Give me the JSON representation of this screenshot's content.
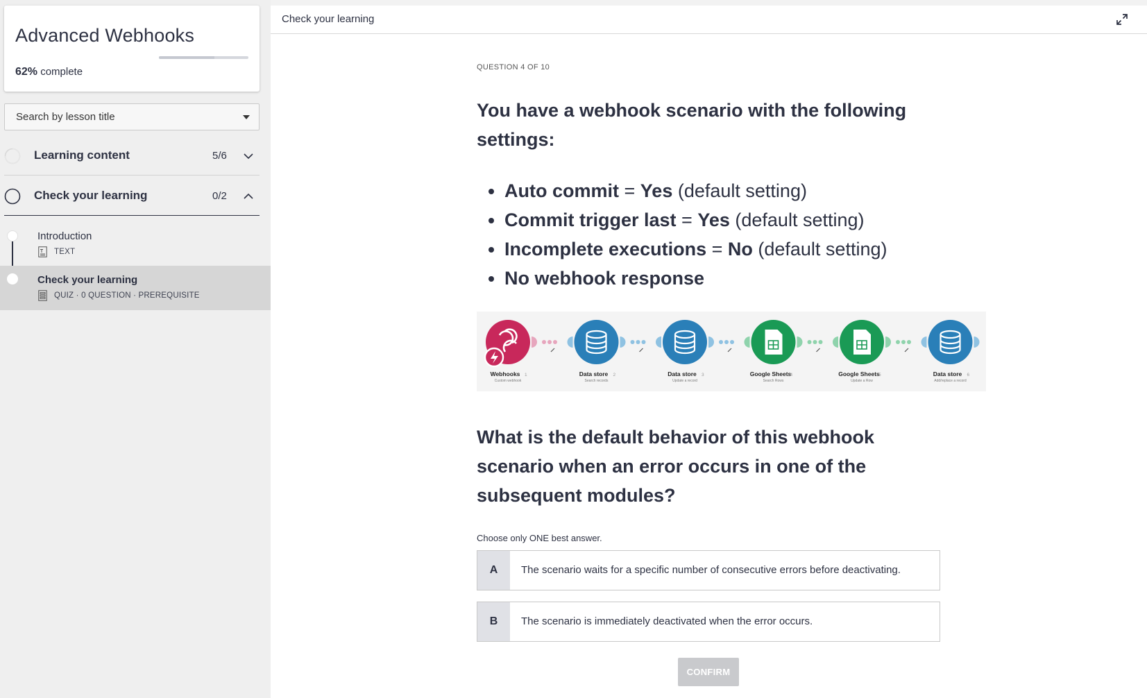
{
  "sidebar": {
    "course_title": "Advanced Webhooks",
    "progress_percent": "62%",
    "progress_suffix": "complete",
    "progress_fraction": 0.62,
    "search_placeholder": "Search by lesson title",
    "sections": [
      {
        "label": "Learning content",
        "count": "5/6",
        "state": "collapsed"
      },
      {
        "label": "Check your learning",
        "count": "0/2",
        "state": "expanded"
      }
    ],
    "lessons": [
      {
        "title": "Introduction",
        "meta": "TEXT",
        "icon": "text-doc-icon"
      },
      {
        "title": "Check your learning",
        "meta": "QUIZ · 0 QUESTION · PREREQUISITE",
        "icon": "quiz-icon"
      }
    ]
  },
  "main": {
    "topbar_title": "Check your learning",
    "question_number": "QUESTION 4 OF 10",
    "question_heading": "You have a webhook scenario with the following settings:",
    "settings": [
      {
        "key": "Auto commit",
        "eq": " = ",
        "value": "Yes",
        "note": " (default setting)"
      },
      {
        "key": "Commit trigger last",
        "eq": " = ",
        "value": "Yes",
        "note": " (default setting)"
      },
      {
        "key": "Incomplete executions",
        "eq": " = ",
        "value": "No",
        "note": " (default setting)"
      },
      {
        "key": "No webhook response",
        "eq": "",
        "value": "",
        "note": ""
      }
    ],
    "diagram": {
      "modules": [
        {
          "name": "Webhooks",
          "num": "1",
          "sub": "Custom webhook",
          "color": "#c8285b",
          "icon": "webhook-icon"
        },
        {
          "name": "Data store",
          "num": "2",
          "sub": "Search records",
          "color": "#2a7fb8",
          "icon": "database-icon"
        },
        {
          "name": "Data store",
          "num": "3",
          "sub": "Update a record",
          "color": "#2a7fb8",
          "icon": "database-icon"
        },
        {
          "name": "Google Sheets",
          "num": "4",
          "sub": "Search Rows",
          "color": "#1a9a55",
          "icon": "sheet-icon"
        },
        {
          "name": "Google Sheets",
          "num": "5",
          "sub": "Update a Row",
          "color": "#1a9a55",
          "icon": "sheet-icon"
        },
        {
          "name": "Data store",
          "num": "6",
          "sub": "Add/replace a record",
          "color": "#2a7fb8",
          "icon": "database-icon"
        }
      ]
    },
    "question_body": "What is the default behavior of this webhook scenario when an error occurs in one of the subsequent modules?",
    "instruction": "Choose only ONE best answer.",
    "options": [
      {
        "letter": "A",
        "text": "The scenario waits for a specific number of consecutive errors before deactivating."
      },
      {
        "letter": "B",
        "text": "The scenario is immediately deactivated when the error occurs."
      }
    ],
    "confirm_label": "CONFIRM"
  }
}
